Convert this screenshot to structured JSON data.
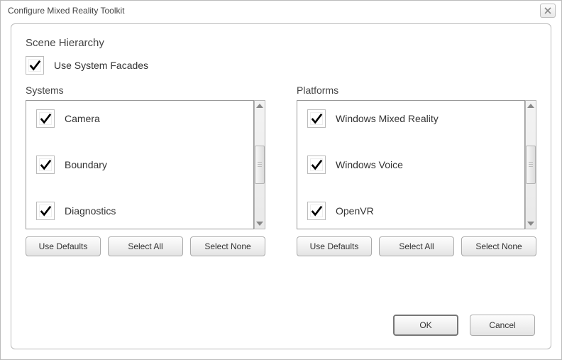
{
  "window": {
    "title": "Configure Mixed Reality Toolkit"
  },
  "scene": {
    "heading": "Scene Hierarchy",
    "facades_label": "Use System Facades",
    "facades_checked": true
  },
  "systems": {
    "heading": "Systems",
    "items": [
      {
        "label": "Camera",
        "checked": true
      },
      {
        "label": "Boundary",
        "checked": true
      },
      {
        "label": "Diagnostics",
        "checked": true
      }
    ],
    "buttons": {
      "defaults": "Use Defaults",
      "select_all": "Select All",
      "select_none": "Select None"
    }
  },
  "platforms": {
    "heading": "Platforms",
    "items": [
      {
        "label": "Windows Mixed Reality",
        "checked": true
      },
      {
        "label": "Windows Voice",
        "checked": true
      },
      {
        "label": "OpenVR",
        "checked": true
      }
    ],
    "buttons": {
      "defaults": "Use Defaults",
      "select_all": "Select All",
      "select_none": "Select None"
    }
  },
  "footer": {
    "ok": "OK",
    "cancel": "Cancel"
  },
  "icons": {
    "close": "close-icon",
    "check": "check-icon",
    "scroll_up": "chevron-up-icon",
    "scroll_down": "chevron-down-icon"
  }
}
